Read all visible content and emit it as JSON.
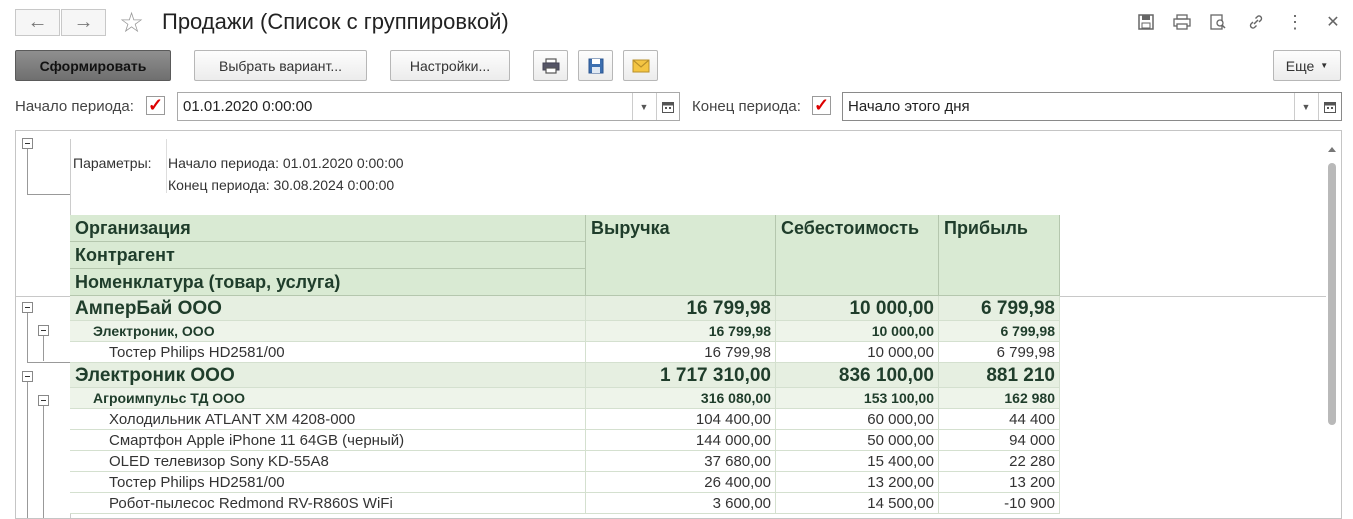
{
  "window": {
    "title": "Продажи (Список с группировкой)",
    "nav_back_icon": "←",
    "nav_forward_icon": "→",
    "favorite_icon": "☆"
  },
  "toolbar": {
    "generate_label": "Сформировать",
    "choose_variant_label": "Выбрать вариант...",
    "settings_label": "Настройки...",
    "more_label": "Еще"
  },
  "period": {
    "start_label": "Начало периода:",
    "start_value": "01.01.2020  0:00:00",
    "end_label": "Конец периода:",
    "end_value": "Начало этого дня"
  },
  "report": {
    "params_label": "Параметры:",
    "params_line1": "Начало периода: 01.01.2020 0:00:00",
    "params_line2": "Конец периода: 30.08.2024 0:00:00",
    "headers": {
      "org": "Организация",
      "contractor": "Контрагент",
      "item": "Номенклатура (товар, услуга)",
      "revenue": "Выручка",
      "cost": "Себестоимость",
      "profit": "Прибыль"
    },
    "rows": [
      {
        "level": 1,
        "name": "АмперБай ООО",
        "revenue": "16 799,98",
        "cost": "10 000,00",
        "profit": "6 799,98"
      },
      {
        "level": 2,
        "name": "Электроник, ООО",
        "revenue": "16 799,98",
        "cost": "10 000,00",
        "profit": "6 799,98"
      },
      {
        "level": 3,
        "name": "Тостер Philips HD2581/00",
        "revenue": "16 799,98",
        "cost": "10 000,00",
        "profit": "6 799,98"
      },
      {
        "level": 1,
        "name": "Электроник ООО",
        "revenue": "1 717 310,00",
        "cost": "836 100,00",
        "profit": "881 210"
      },
      {
        "level": 2,
        "name": "Агроимпульс ТД ООО",
        "revenue": "316 080,00",
        "cost": "153 100,00",
        "profit": "162 980"
      },
      {
        "level": 3,
        "name": "Холодильник ATLANT ХМ 4208-000",
        "revenue": "104 400,00",
        "cost": "60 000,00",
        "profit": "44 400"
      },
      {
        "level": 3,
        "name": "Смартфон Apple iPhone 11 64GB (черный)",
        "revenue": "144 000,00",
        "cost": "50 000,00",
        "profit": "94 000"
      },
      {
        "level": 3,
        "name": "OLED телевизор Sony KD-55A8",
        "revenue": "37 680,00",
        "cost": "15 400,00",
        "profit": "22 280"
      },
      {
        "level": 3,
        "name": "Тостер Philips HD2581/00",
        "revenue": "26 400,00",
        "cost": "13 200,00",
        "profit": "13 200"
      },
      {
        "level": 3,
        "name": "Робот-пылесос Redmond RV-R860S WiFi",
        "revenue": "3 600,00",
        "cost": "14 500,00",
        "profit": "-10 900"
      }
    ]
  }
}
